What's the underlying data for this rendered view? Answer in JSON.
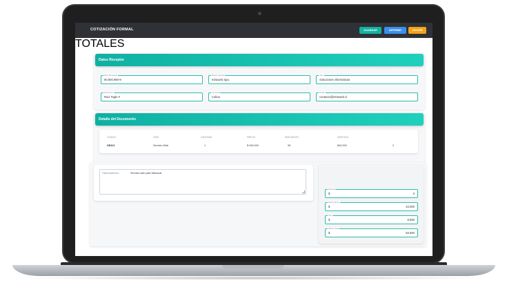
{
  "app": {
    "title": "COTIZACIÓN FORMAL",
    "buttons": {
      "save": "GUARDAR",
      "print": "IMPRIMIR",
      "back": "VOLVER"
    }
  },
  "receptor": {
    "header": "Datos Receptor",
    "fields": {
      "rut": {
        "label": "RUT Receptor",
        "value": "90.900.990-9"
      },
      "razon": {
        "label": "Razón Social",
        "value": "Intraweb Spa."
      },
      "giro": {
        "label": "Giro",
        "value": "Soluciones informáticas"
      },
      "direccion": {
        "label": "Dirección",
        "value": "Ruiz Tagle #"
      },
      "comuna": {
        "label": "Comuna",
        "value": "Colina"
      },
      "email": {
        "label": "Email",
        "value": "contacto@intraweb.cl"
      }
    }
  },
  "detalle": {
    "header": "Detalle del Documento",
    "columns": [
      "CÓDIGO",
      "ÍTEM",
      "CANTIDAD",
      "PRECIO",
      "DESCUENTO",
      "SUBTOTAL"
    ],
    "row": {
      "codigo": "DE421",
      "item": "Servicio Web",
      "cantidad": "1",
      "precio": "$ 045.000",
      "descuento": "05",
      "subtotal": "$43.000",
      "extra": "2"
    }
  },
  "observaciones": {
    "label": "Observaciones:",
    "value": "Servicio web plan Mensual"
  },
  "totales": {
    "title": "TOTALES",
    "descto": {
      "label": "Descto",
      "symbol": "$",
      "value": "0"
    },
    "neto": {
      "label": "Monto Neto",
      "symbol": "$",
      "value": "43.000"
    },
    "iva": {
      "label": "IVA",
      "symbol": "$",
      "value": "8.550"
    },
    "total": {
      "label": "Monto Total",
      "symbol": "$",
      "value": "53.550"
    }
  },
  "colors": {
    "accent": "#12b3a1",
    "print": "#3b8ff0",
    "back": "#f4a31a",
    "topbar": "#2f3136"
  }
}
